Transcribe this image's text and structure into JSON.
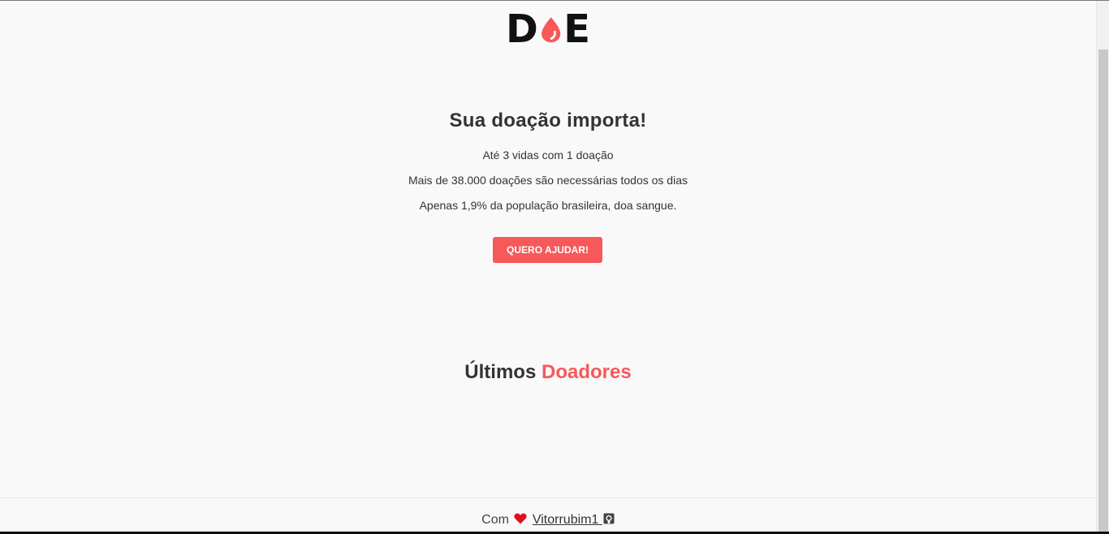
{
  "logo": {
    "left": "D",
    "right": "E",
    "accent_color": "#f7585a"
  },
  "hero": {
    "title": "Sua doação importa!",
    "line1": "Até 3 vidas com 1 doação",
    "line2": "Mais de 38.000 doações são necessárias todos os dias",
    "line3": "Apenas 1,9% da população brasileira, doa sangue.",
    "button_label": "QUERO AJUDAR!"
  },
  "donors": {
    "title_part1": "Últimos",
    "title_part2": "Doadores"
  },
  "footer": {
    "prefix": "Com",
    "heart_icon": "heart-icon",
    "author": "Vitorrubim1",
    "github_icon": "github-icon"
  },
  "colors": {
    "accent": "#f7585a",
    "text": "#333333",
    "background": "#f9f9f9"
  }
}
